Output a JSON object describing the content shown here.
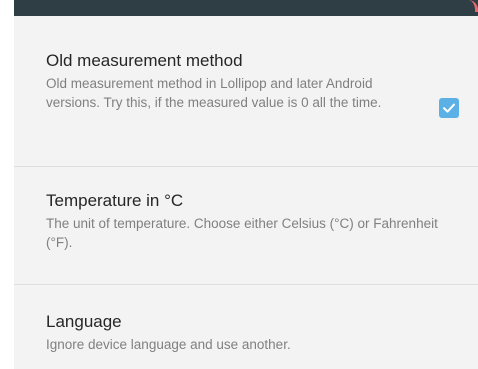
{
  "settings": {
    "old_measurement": {
      "title": "Old measurement method",
      "summary": "Old measurement method in Lollipop and later Android versions. Try this, if the measured value is 0 all the time.",
      "checked": true
    },
    "temperature": {
      "title": "Temperature in °C",
      "summary": "The unit of temperature. Choose either Celsius (°C) or Fahrenheit (°F)."
    },
    "language": {
      "title": "Language",
      "summary": "Ignore device language and use another."
    }
  },
  "colors": {
    "top_bar": "#2f3d44",
    "checkbox_accent": "#5bb1e6",
    "background": "#f3f3f3"
  },
  "icons": {
    "checkbox": "check-icon"
  }
}
